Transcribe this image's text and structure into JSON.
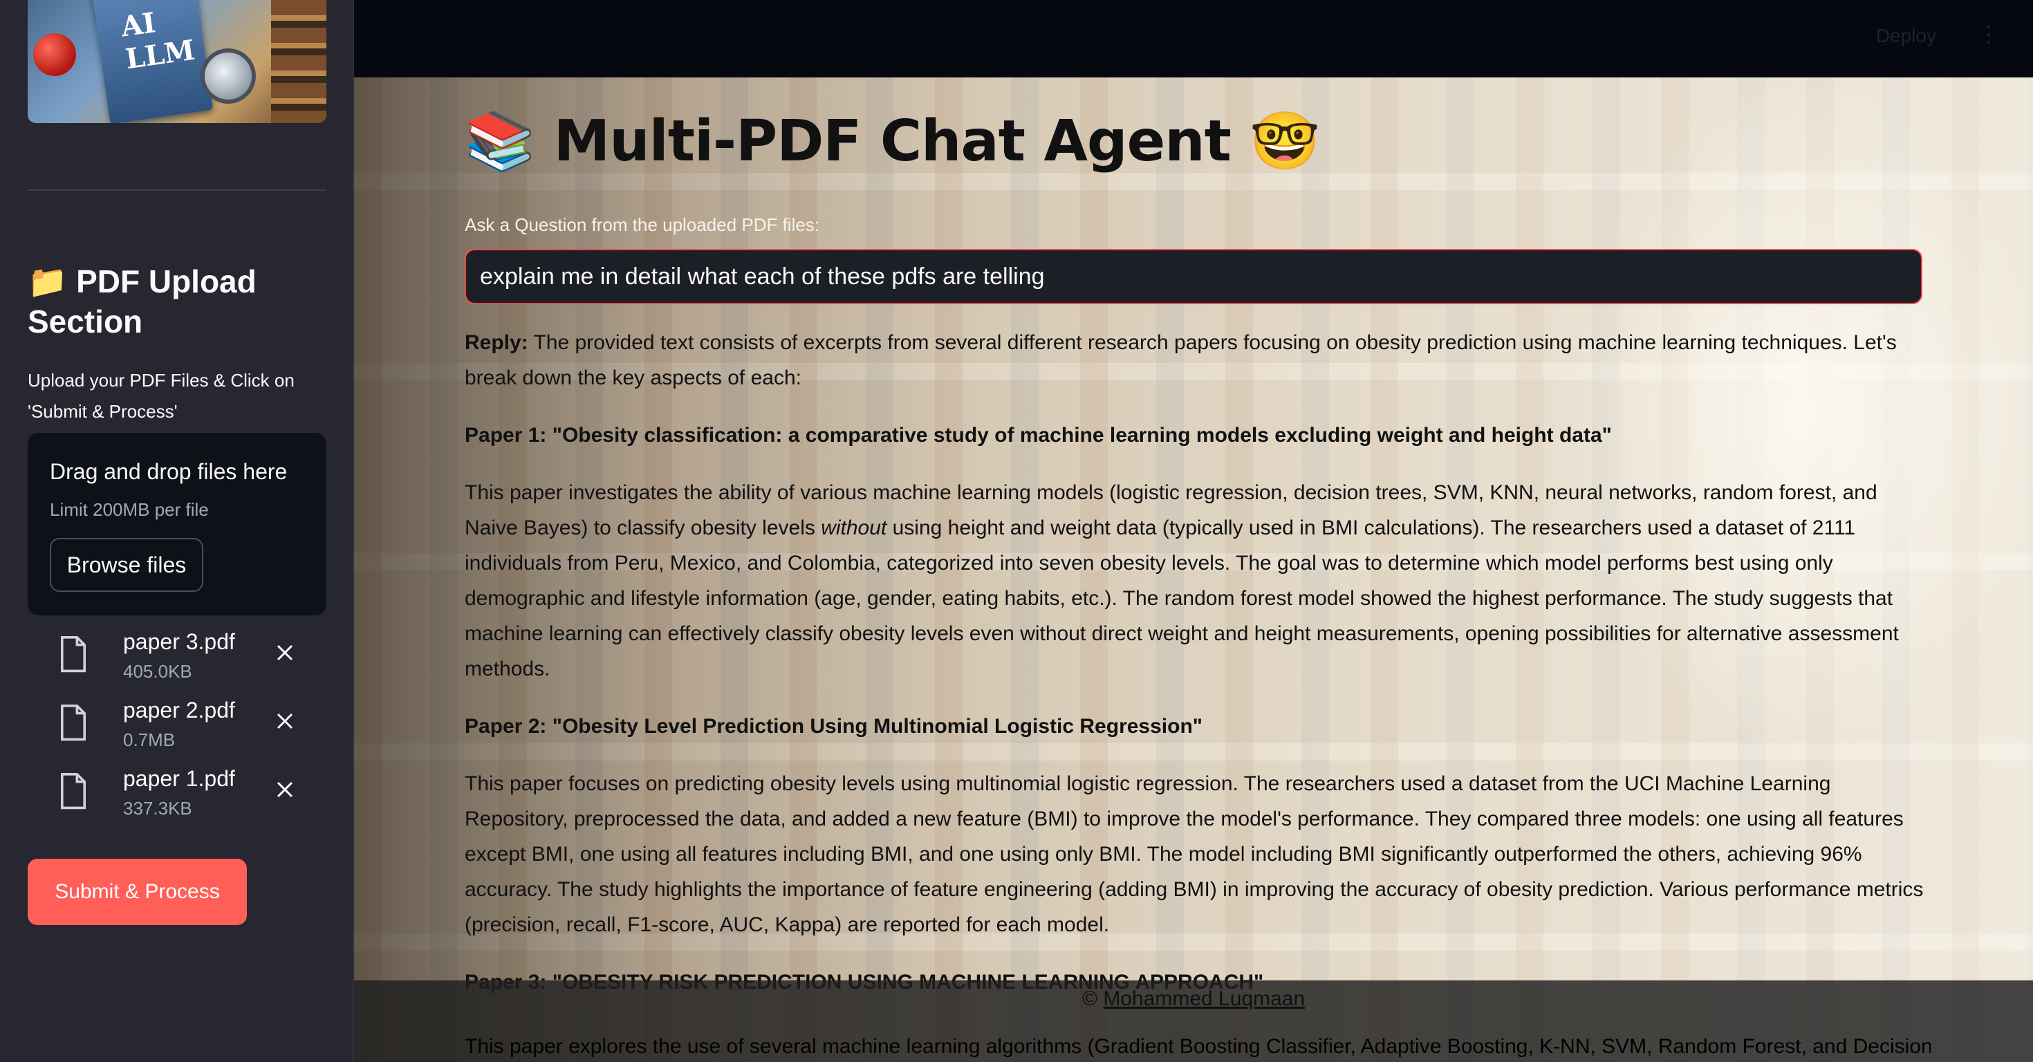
{
  "sidebar": {
    "hero_text": "AI LLM",
    "title_icon": "📁",
    "title": "PDF Upload Section",
    "subtitle": "Upload your PDF Files & Click on 'Submit & Process'",
    "dropzone": {
      "title": "Drag and drop files here",
      "limit": "Limit 200MB per file",
      "browse_label": "Browse files"
    },
    "files": [
      {
        "name": "paper 3.pdf",
        "size": "405.0KB"
      },
      {
        "name": "paper 2.pdf",
        "size": "0.7MB"
      },
      {
        "name": "paper 1.pdf",
        "size": "337.3KB"
      }
    ],
    "submit_label": "Submit & Process"
  },
  "topbar": {
    "deploy_label": "Deploy",
    "menu_icon": "⋮"
  },
  "main": {
    "title_icon": "📚",
    "title": "Multi-PDF Chat Agent",
    "title_emoji": "🤓",
    "question_label": "Ask a Question from the uploaded PDF files:",
    "question_value": "explain me in detail what each of these pdfs are telling",
    "reply": {
      "label": "Reply:",
      "intro": "The provided text consists of excerpts from several different research papers focusing on obesity prediction using machine learning techniques. Let's break down the key aspects of each:",
      "paper1_heading": "Paper 1: \"Obesity classification: a comparative study of machine learning models excluding weight and height data\"",
      "paper1_a": "This paper investigates the ability of various machine learning models (logistic regression, decision trees, SVM, KNN, neural networks, random forest, and Naive Bayes) to classify obesity levels ",
      "paper1_em": "without",
      "paper1_b": " using height and weight data (typically used in BMI calculations). The researchers used a dataset of 2111 individuals from Peru, Mexico, and Colombia, categorized into seven obesity levels. The goal was to determine which model performs best using only demographic and lifestyle information (age, gender, eating habits, etc.). The random forest model showed the highest performance. The study suggests that machine learning can effectively classify obesity levels even without direct weight and height measurements, opening possibilities for alternative assessment methods.",
      "paper2_heading": "Paper 2: \"Obesity Level Prediction Using Multinomial Logistic Regression\"",
      "paper2_body": "This paper focuses on predicting obesity levels using multinomial logistic regression. The researchers used a dataset from the UCI Machine Learning Repository, preprocessed the data, and added a new feature (BMI) to improve the model's performance. They compared three models: one using all features except BMI, one using all features including BMI, and one using only BMI. The model including BMI significantly outperformed the others, achieving 96% accuracy. The study highlights the importance of feature engineering (adding BMI) in improving the accuracy of obesity prediction. Various performance metrics (precision, recall, F1-score, AUC, Kappa) are reported for each model.",
      "paper3_heading": "Paper 3: \"OBESITY RISK PREDICTION USING MACHINE LEARNING APPROACH\"",
      "paper3_body": "This paper explores the use of several machine learning algorithms (Gradient Boosting Classifier, Adaptive Boosting, K-NN, SVM, Random Forest, and Decision"
    }
  },
  "footer": {
    "copyright": "©",
    "author": "Mohammed Luqmaan"
  }
}
